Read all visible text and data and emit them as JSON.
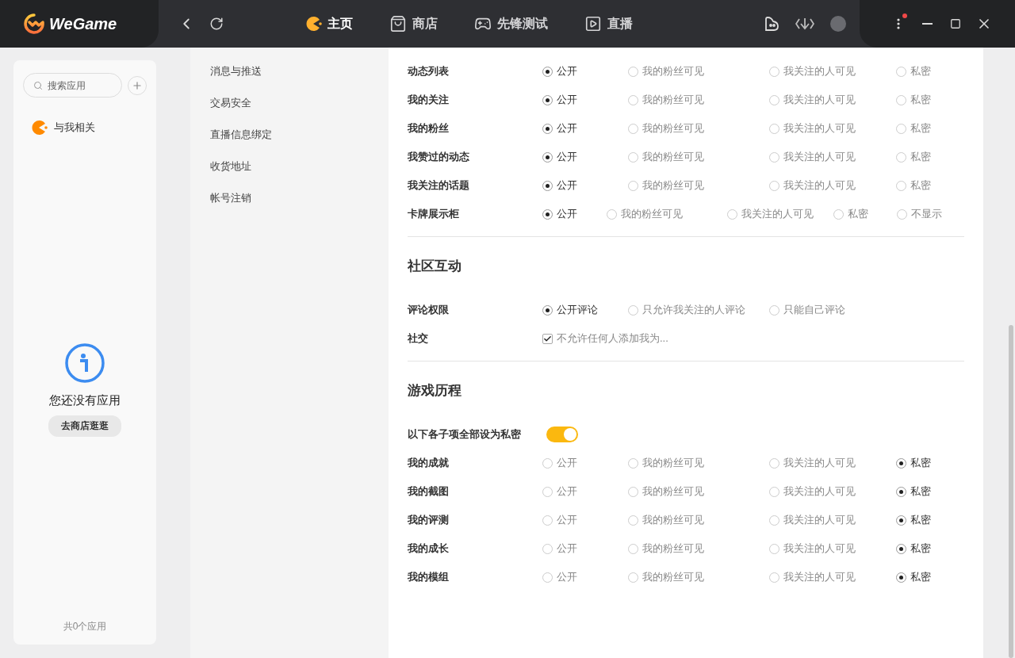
{
  "titlebar": {
    "logo": "WeGame",
    "nav": [
      {
        "label": "主页",
        "selected": true
      },
      {
        "label": "商店",
        "selected": false
      },
      {
        "label": "先锋测试",
        "selected": false
      },
      {
        "label": "直播",
        "selected": false
      }
    ],
    "notification_dot": true
  },
  "sidebar": {
    "search": {
      "placeholder": "搜索应用"
    },
    "items": [
      {
        "label": "与我相关"
      }
    ],
    "empty": {
      "message": "您还没有应用",
      "button": "去商店逛逛"
    },
    "footer": "共0个应用"
  },
  "menu": [
    "消息与推送",
    "交易安全",
    "直播信息绑定",
    "收货地址",
    "帐号注销"
  ],
  "sections": [
    {
      "rows": [
        {
          "kind": "radio",
          "label": "动态列表",
          "options": [
            {
              "label": "公开",
              "selected": true
            },
            {
              "label": "我的粉丝可见",
              "selected": false
            },
            {
              "label": "我关注的人可见",
              "selected": false
            },
            {
              "label": "私密",
              "selected": false
            }
          ]
        },
        {
          "kind": "radio",
          "label": "我的关注",
          "options": [
            {
              "label": "公开",
              "selected": true
            },
            {
              "label": "我的粉丝可见",
              "selected": false
            },
            {
              "label": "我关注的人可见",
              "selected": false
            },
            {
              "label": "私密",
              "selected": false
            }
          ]
        },
        {
          "kind": "radio",
          "label": "我的粉丝",
          "options": [
            {
              "label": "公开",
              "selected": true
            },
            {
              "label": "我的粉丝可见",
              "selected": false
            },
            {
              "label": "我关注的人可见",
              "selected": false
            },
            {
              "label": "私密",
              "selected": false
            }
          ]
        },
        {
          "kind": "radio",
          "label": "我赞过的动态",
          "options": [
            {
              "label": "公开",
              "selected": true
            },
            {
              "label": "我的粉丝可见",
              "selected": false
            },
            {
              "label": "我关注的人可见",
              "selected": false
            },
            {
              "label": "私密",
              "selected": false
            }
          ]
        },
        {
          "kind": "radio",
          "label": "我关注的话题",
          "options": [
            {
              "label": "公开",
              "selected": true
            },
            {
              "label": "我的粉丝可见",
              "selected": false
            },
            {
              "label": "我关注的人可见",
              "selected": false
            },
            {
              "label": "私密",
              "selected": false
            }
          ]
        },
        {
          "kind": "radio",
          "label": "卡牌展示柜",
          "options": [
            {
              "label": "公开",
              "selected": true
            },
            {
              "label": "我的粉丝可见",
              "selected": false
            },
            {
              "label": "我关注的人可见",
              "selected": false
            },
            {
              "label": "私密",
              "selected": false
            },
            {
              "label": "不显示",
              "selected": false
            }
          ]
        }
      ]
    },
    {
      "title": "社区互动",
      "rows": [
        {
          "kind": "radio",
          "label": "评论权限",
          "options": [
            {
              "label": "公开评论",
              "selected": true
            },
            {
              "label": "只允许我关注的人评论",
              "selected": false
            },
            {
              "label": "只能自己评论",
              "selected": false
            }
          ]
        },
        {
          "kind": "checkbox",
          "label": "社交",
          "options": [
            {
              "label": "不允许任何人添加我为...",
              "checked": true
            }
          ]
        }
      ]
    },
    {
      "title": "游戏历程",
      "rows": [
        {
          "kind": "toggle",
          "label": "以下各子项全部设为私密",
          "on": true
        },
        {
          "kind": "radio",
          "label": "我的成就",
          "options": [
            {
              "label": "公开",
              "selected": false
            },
            {
              "label": "我的粉丝可见",
              "selected": false
            },
            {
              "label": "我关注的人可见",
              "selected": false
            },
            {
              "label": "私密",
              "selected": true
            }
          ]
        },
        {
          "kind": "radio",
          "label": "我的截图",
          "options": [
            {
              "label": "公开",
              "selected": false
            },
            {
              "label": "我的粉丝可见",
              "selected": false
            },
            {
              "label": "我关注的人可见",
              "selected": false
            },
            {
              "label": "私密",
              "selected": true
            }
          ]
        },
        {
          "kind": "radio",
          "label": "我的评测",
          "options": [
            {
              "label": "公开",
              "selected": false
            },
            {
              "label": "我的粉丝可见",
              "selected": false
            },
            {
              "label": "我关注的人可见",
              "selected": false
            },
            {
              "label": "私密",
              "selected": true
            }
          ]
        },
        {
          "kind": "radio",
          "label": "我的成长",
          "options": [
            {
              "label": "公开",
              "selected": false
            },
            {
              "label": "我的粉丝可见",
              "selected": false
            },
            {
              "label": "我关注的人可见",
              "selected": false
            },
            {
              "label": "私密",
              "selected": true
            }
          ]
        },
        {
          "kind": "radio",
          "label": "我的模组",
          "options": [
            {
              "label": "公开",
              "selected": false
            },
            {
              "label": "我的粉丝可见",
              "selected": false
            },
            {
              "label": "我关注的人可见",
              "selected": false
            },
            {
              "label": "私密",
              "selected": true
            }
          ]
        }
      ]
    }
  ]
}
